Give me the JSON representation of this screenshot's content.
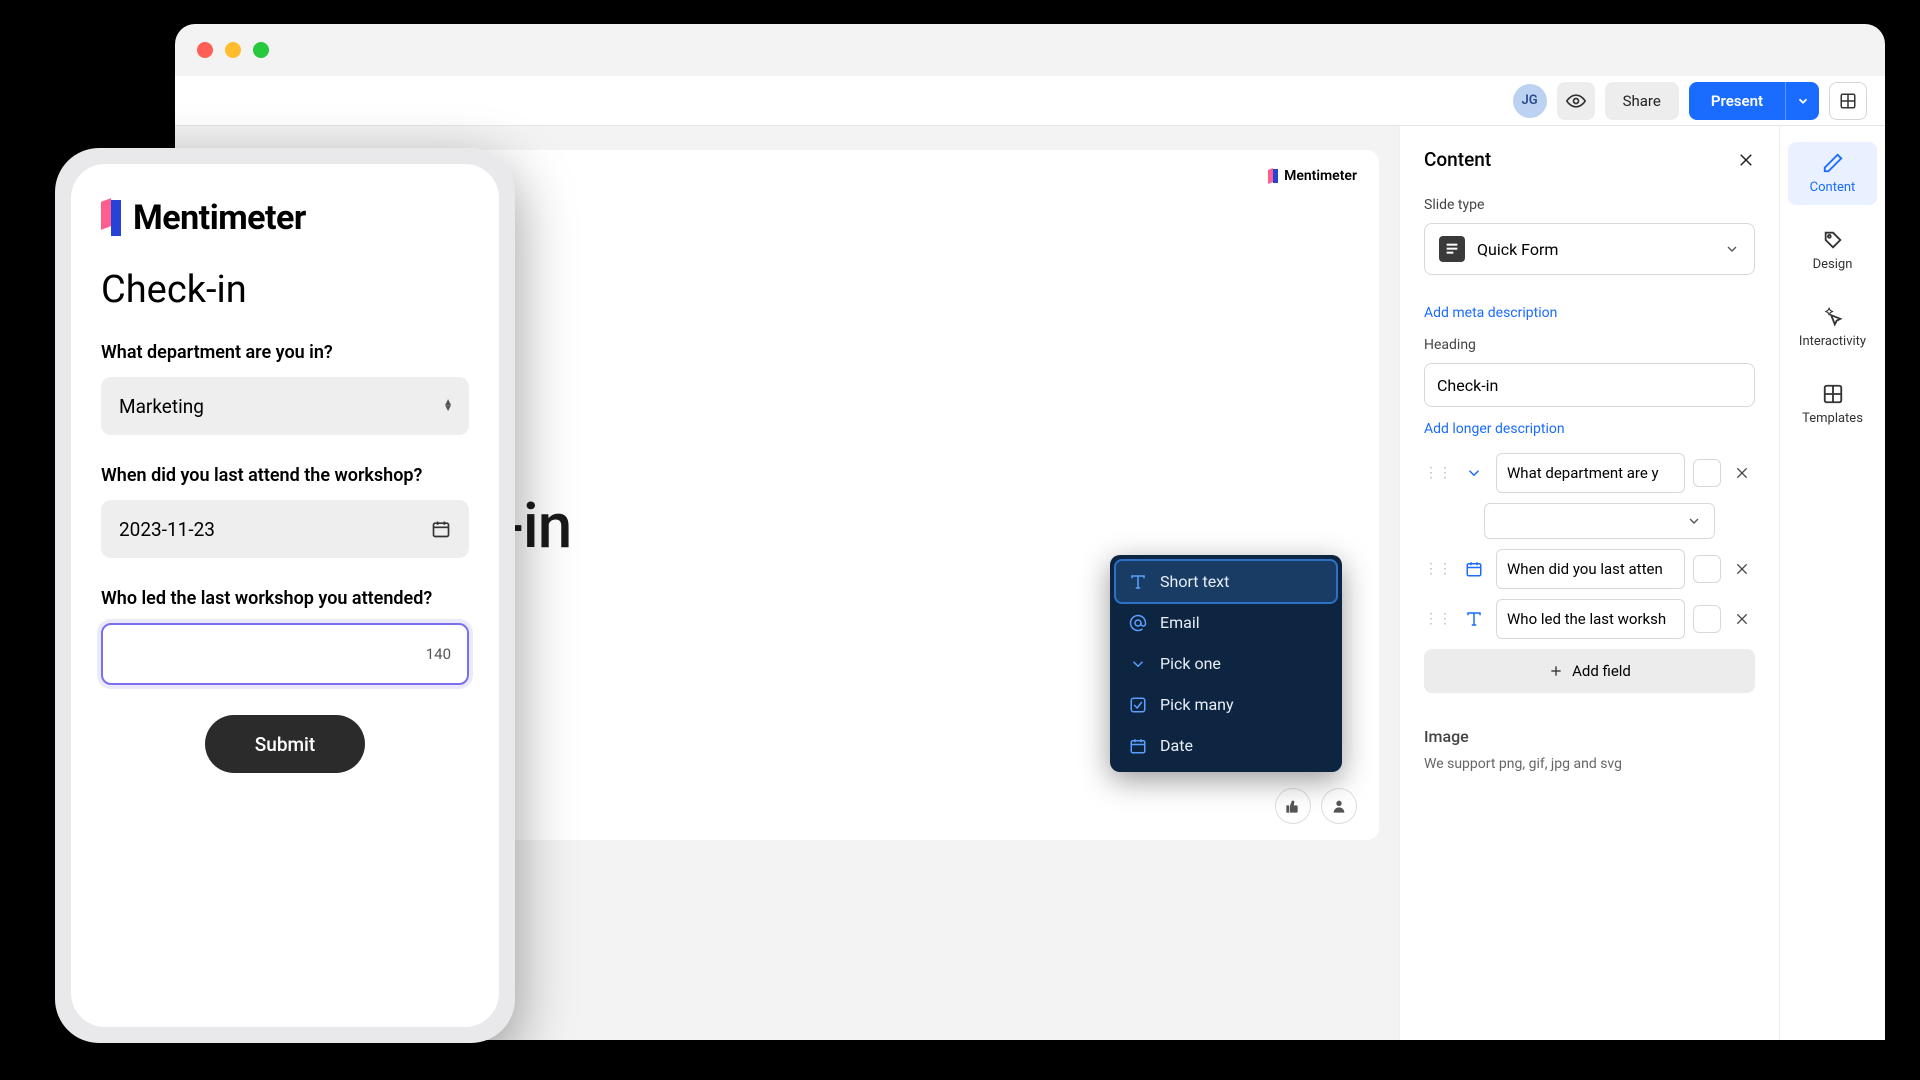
{
  "brand": "Mentimeter",
  "topbar": {
    "avatar": "JG",
    "share": "Share",
    "present": "Present"
  },
  "slide": {
    "title": "Check-in"
  },
  "rail": {
    "title": "Content",
    "slide_type_label": "Slide type",
    "slide_type_value": "Quick Form",
    "add_meta": "Add meta description",
    "heading_label": "Heading",
    "heading_value": "Check-in",
    "add_longer": "Add longer description",
    "fields": {
      "f0": "What department are y",
      "f1": "When did you last atten",
      "f2": "Who led the last worksh"
    },
    "add_field": "Add field",
    "image_label": "Image",
    "image_help": "We support png, gif, jpg and svg"
  },
  "side_tabs": {
    "content": "Content",
    "design": "Design",
    "interactivity": "Interactivity",
    "templates": "Templates"
  },
  "popup": {
    "short_text": "Short text",
    "email": "Email",
    "pick_one": "Pick one",
    "pick_many": "Pick many",
    "date": "Date"
  },
  "phone": {
    "title": "Check-in",
    "q1": "What department are you in?",
    "q1_value": "Marketing",
    "q2": "When did you last attend the workshop?",
    "q2_value": "2023-11-23",
    "q3": "Who led the last workshop you attended?",
    "q3_count": "140",
    "submit": "Submit"
  }
}
